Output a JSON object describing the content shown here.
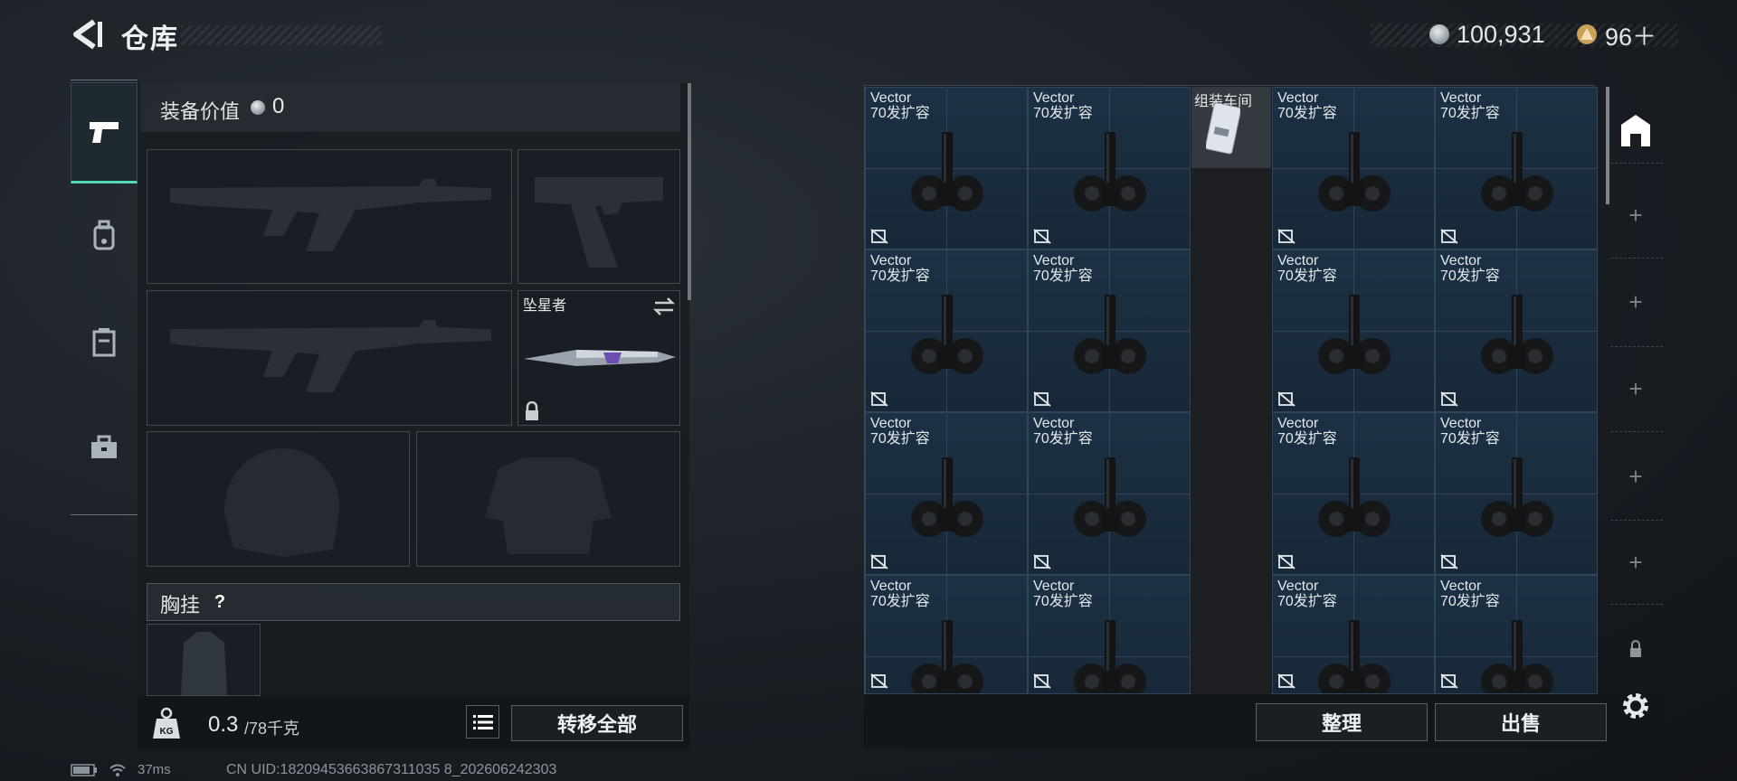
{
  "header": {
    "title": "仓库",
    "currencies": [
      {
        "icon": "silver-coin-icon",
        "value": "100,931"
      },
      {
        "icon": "gold-triangle-coin-icon",
        "value": "96＋"
      }
    ]
  },
  "tabs": [
    {
      "icon": "pistol-icon",
      "active": true
    },
    {
      "icon": "backpack-icon",
      "active": false
    },
    {
      "icon": "vest-icon",
      "active": false
    },
    {
      "icon": "toolbox-icon",
      "active": false
    }
  ],
  "loadout": {
    "value_label": "装备价值",
    "value": "0",
    "melee_name": "坠星者",
    "chest_label": "胸挂",
    "chest_help": "?",
    "weight_value": "0.3",
    "weight_unit": "/78千克",
    "transfer_all": "转移全部"
  },
  "stash": {
    "items": [
      {
        "name": "Vector",
        "sub": "70发扩容"
      },
      {
        "name": "Vector",
        "sub": "70发扩容"
      },
      {
        "name": "Vector",
        "sub": "70发扩容"
      },
      {
        "name": "Vector",
        "sub": "70发扩容"
      },
      {
        "name": "Vector",
        "sub": "70发扩容"
      },
      {
        "name": "Vector",
        "sub": "70发扩容"
      },
      {
        "name": "Vector",
        "sub": "70发扩容"
      },
      {
        "name": "Vector",
        "sub": "70发扩容"
      },
      {
        "name": "Vector",
        "sub": "70发扩容"
      },
      {
        "name": "Vector",
        "sub": "70发扩容"
      },
      {
        "name": "Vector",
        "sub": "70发扩容"
      },
      {
        "name": "Vector",
        "sub": "70发扩容"
      },
      {
        "name": "Vector",
        "sub": "70发扩容"
      },
      {
        "name": "Vector",
        "sub": "70发扩容"
      },
      {
        "name": "Vector",
        "sub": "70发扩容"
      },
      {
        "name": "Vector",
        "sub": "70发扩容"
      }
    ],
    "workshop_label": "组装车间",
    "sort": "整理",
    "sell": "出售"
  },
  "status": {
    "ping": "37ms",
    "uid": "CN UID:18209453663867311035 8_202606242303"
  },
  "colors": {
    "accent": "#52d6b8",
    "cell": "#1c3144"
  }
}
